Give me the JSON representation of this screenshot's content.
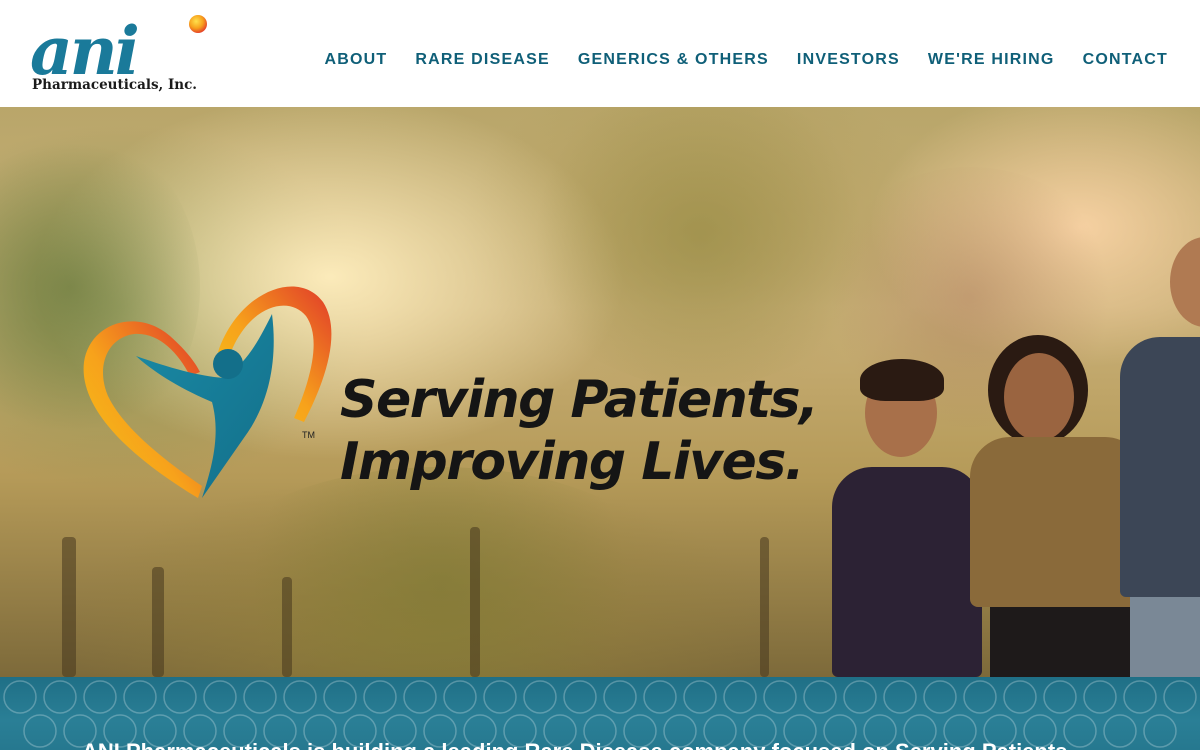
{
  "header": {
    "logo": {
      "wordmark": "ani",
      "company": "Pharmaceuticals, Inc.",
      "icon": "ani-logo-icon"
    },
    "nav": [
      {
        "label": "ABOUT"
      },
      {
        "label": "RARE DISEASE"
      },
      {
        "label": "GENERICS & OTHERS"
      },
      {
        "label": "INVESTORS"
      },
      {
        "label": "WE'RE HIRING"
      },
      {
        "label": "CONTACT"
      }
    ]
  },
  "hero": {
    "tagline_line1": "Serving Patients,",
    "tagline_line2": "Improving Lives.",
    "trademark": "TM",
    "logo_icon": "heart-person-icon"
  },
  "band": {
    "text": "ANI Pharmaceuticals is building a leading Rare Disease company focused on Serving Patients"
  },
  "colors": {
    "nav_text": "#0f5f78",
    "brand_teal": "#1a7a9a",
    "band": "#26788f",
    "heart_yellow": "#f5c518",
    "heart_red": "#e03a2a"
  }
}
